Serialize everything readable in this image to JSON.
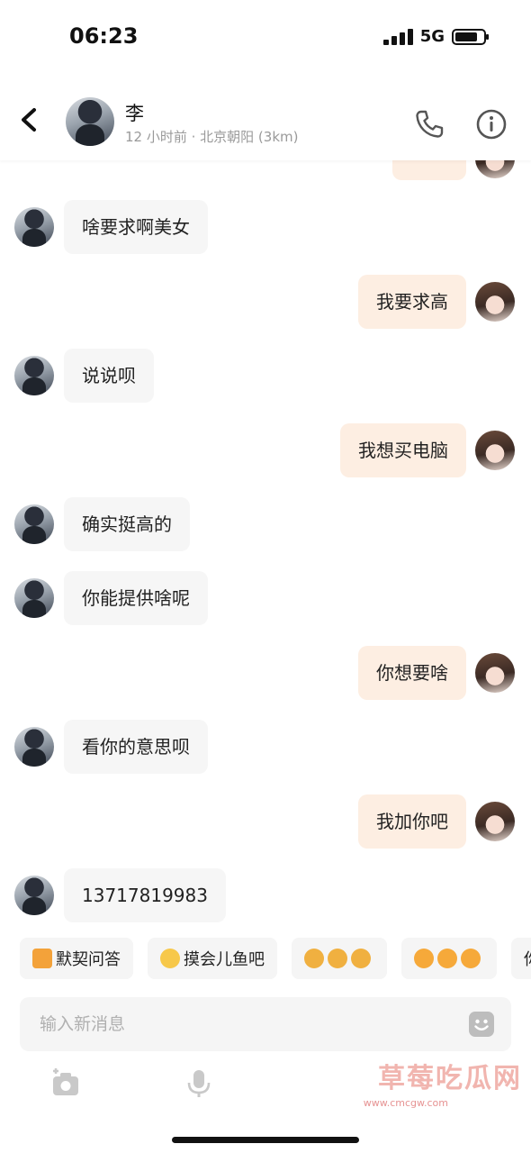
{
  "status_bar": {
    "time": "06:23",
    "network": "5G",
    "battery_level": 0.8
  },
  "header": {
    "contact_name": "李",
    "contact_status": "12 小时前 · 北京朝阳 (3km)"
  },
  "messages": [
    {
      "side": "in",
      "text": "啥要求啊美女"
    },
    {
      "side": "out",
      "text": "我要求高"
    },
    {
      "side": "in",
      "text": "说说呗"
    },
    {
      "side": "out",
      "text": "我想买电脑"
    },
    {
      "side": "in",
      "text": "确实挺高的"
    },
    {
      "side": "in",
      "text": "你能提供啥呢"
    },
    {
      "side": "out",
      "text": "你想要啥"
    },
    {
      "side": "in",
      "text": "看你的意思呗"
    },
    {
      "side": "out",
      "text": "我加你吧"
    },
    {
      "side": "in",
      "text": "13717819983"
    }
  ],
  "quick_replies": [
    {
      "label": "默契问答",
      "icon": "pencil-note-icon"
    },
    {
      "label": "摸会儿鱼吧",
      "icon": "fish-emoji-icon"
    },
    {
      "label": "",
      "icon": "emoji-row-icon"
    },
    {
      "label": "",
      "icon": "emoji-row-icon"
    },
    {
      "label": "你",
      "icon": ""
    }
  ],
  "input": {
    "placeholder": "输入新消息"
  },
  "watermark": {
    "text": "草莓吃瓜网",
    "url": "www.cmcgw.com"
  },
  "colors": {
    "outgoing_bubble": "#fdeee2",
    "incoming_bubble": "#f6f6f6",
    "accent": "#f0a070"
  }
}
